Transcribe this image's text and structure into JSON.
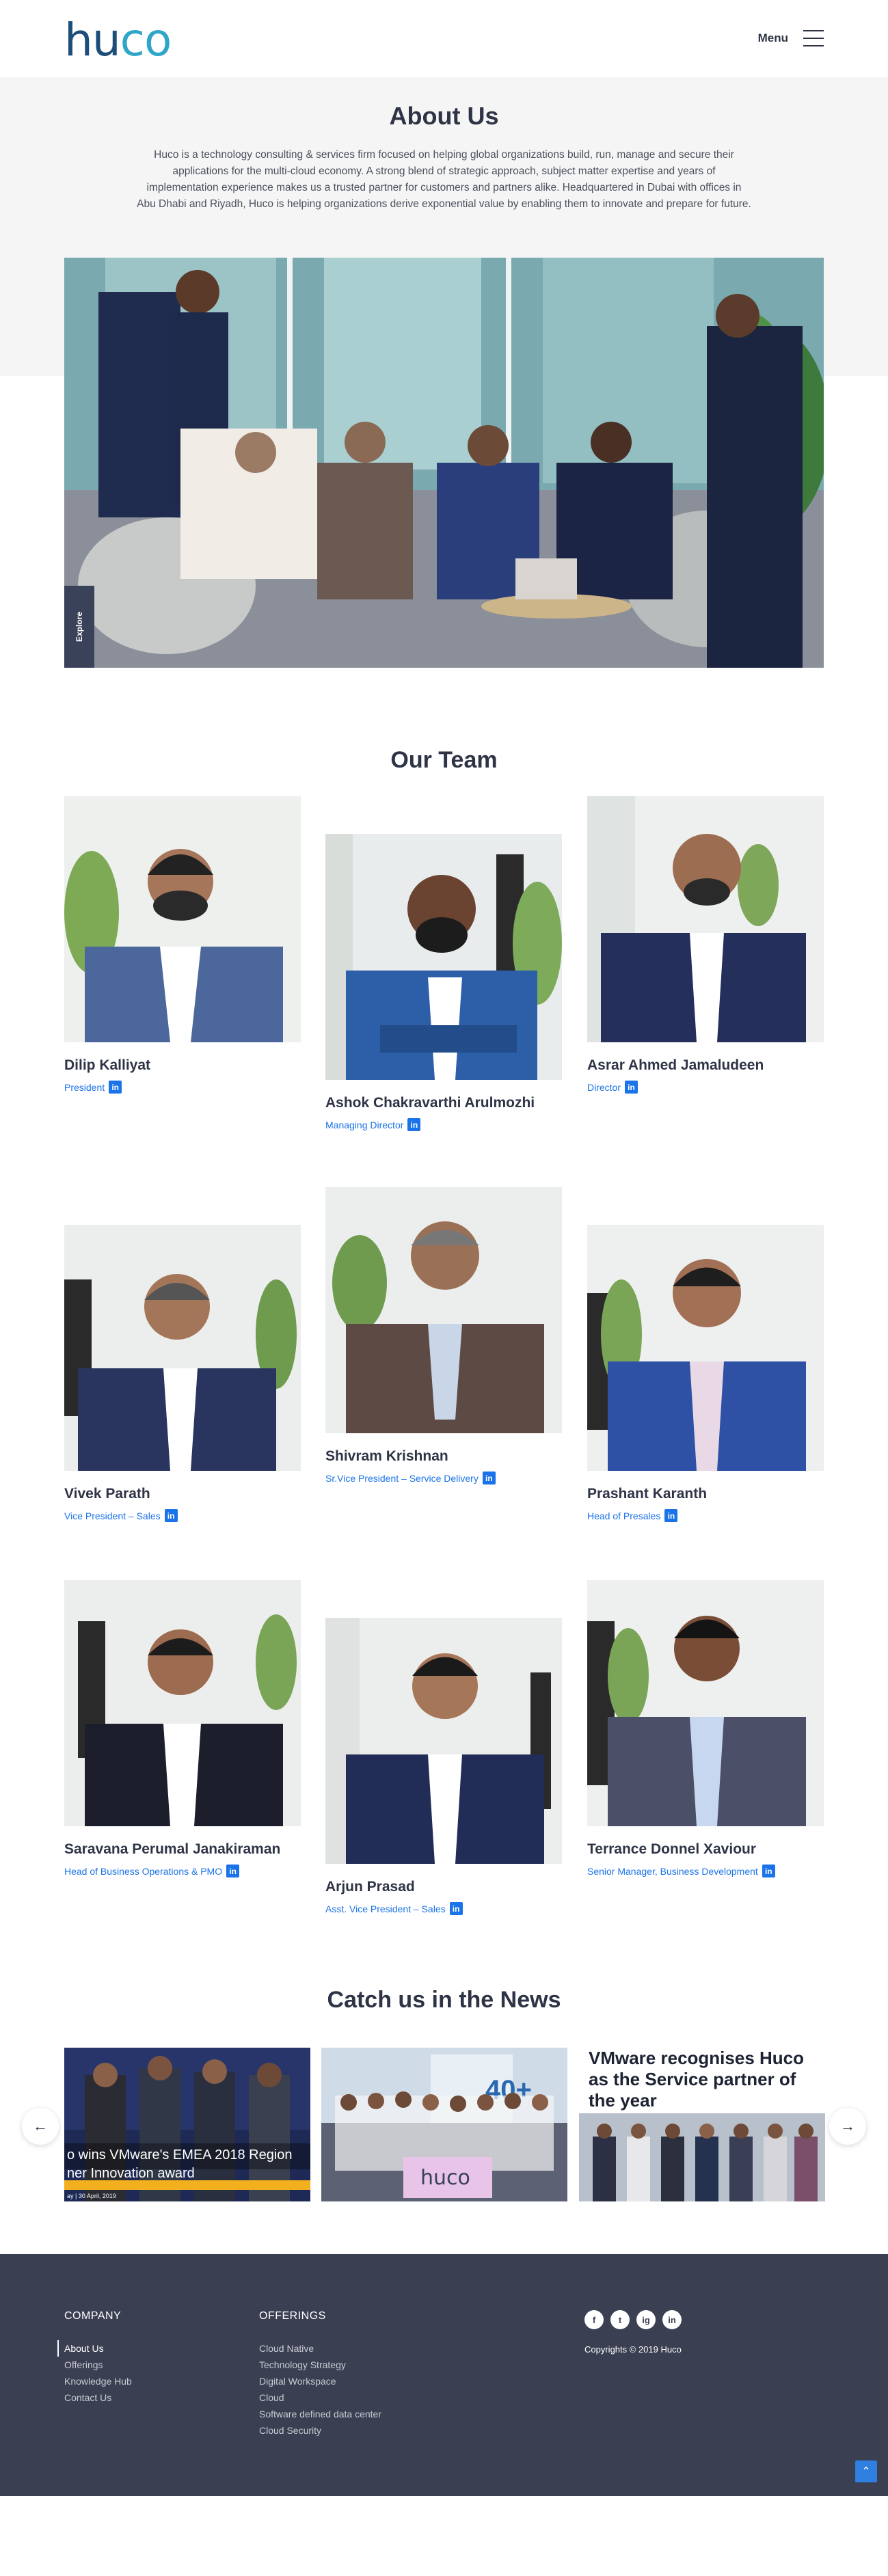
{
  "header": {
    "logo_text_dark": "hu",
    "logo_text_accent": "co",
    "menu_label": "Menu"
  },
  "about": {
    "title": "About Us",
    "description": "Huco is a technology consulting & services firm focused on helping global organizations build, run, manage and secure their applications for the multi-cloud economy. A strong blend of strategic approach, subject matter expertise and years of implementation experience makes us a trusted partner for customers and partners alike. Headquartered in Dubai with offices in Abu Dhabi and Riyadh, Huco is helping organizations derive exponential value by enabling them to innovate and prepare for future.",
    "hero_tag": "Explore"
  },
  "team": {
    "title": "Our Team",
    "members": [
      {
        "name": "Dilip Kalliyat",
        "role": "President"
      },
      {
        "name": "Ashok Chakravarthi Arulmozhi",
        "role": "Managing Director"
      },
      {
        "name": "Asrar Ahmed Jamaludeen",
        "role": "Director"
      },
      {
        "name": "Vivek Parath",
        "role": "Vice President – Sales"
      },
      {
        "name": "Shivram Krishnan",
        "role": "Sr.Vice President – Service Delivery"
      },
      {
        "name": "Prashant Karanth",
        "role": "Head of Presales"
      },
      {
        "name": "Saravana Perumal Janakiraman",
        "role": "Head of Business Operations & PMO"
      },
      {
        "name": "Arjun Prasad",
        "role": "Asst. Vice President – Sales"
      },
      {
        "name": "Terrance Donnel Xaviour",
        "role": "Senior Manager, Business Development"
      }
    ],
    "linkedin_glyph": "in"
  },
  "news": {
    "title": "Catch us in the News",
    "cards": [
      {
        "caption": "o wins VMware's EMEA 2018 Region",
        "caption2": "ner Innovation award",
        "date": "ay | 30 April, 2019"
      },
      {
        "badge": "40+",
        "sign": "huco"
      },
      {
        "headline": "VMware recognises Huco as the Service partner of the year"
      }
    ],
    "prev_glyph": "←",
    "next_glyph": "→"
  },
  "footer": {
    "company_heading": "COMPANY",
    "company_links": [
      "About Us",
      "Offerings",
      "Knowledge Hub",
      "Contact Us"
    ],
    "offerings_heading": "OFFERINGS",
    "offerings_links": [
      "Cloud Native",
      "Technology Strategy",
      "Digital Workspace",
      "Cloud",
      "Software defined data center",
      "Cloud Security"
    ],
    "social": [
      "f",
      "t",
      "ig",
      "in"
    ],
    "copyright": "Copyrights © 2019 Huco",
    "to_top_glyph": "⌃"
  },
  "colors": {
    "brand_dark": "#1d4e79",
    "brand_accent": "#2fa6c8",
    "link_blue": "#1a73e8",
    "footer_bg": "#3b3f52"
  }
}
